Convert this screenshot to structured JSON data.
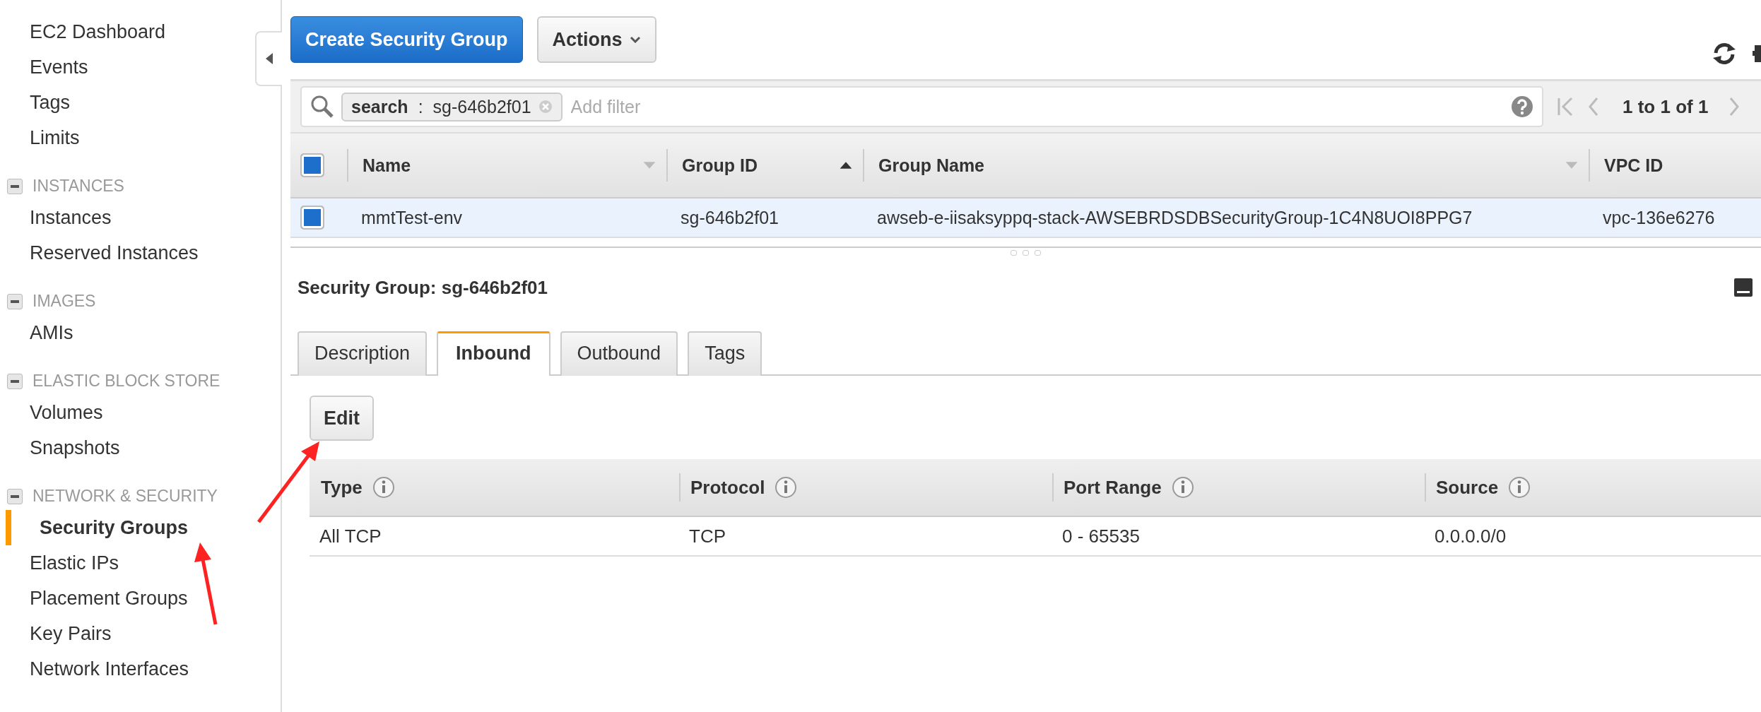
{
  "sidebar": {
    "items": [
      {
        "label": "EC2 Dashboard",
        "selected": false
      },
      {
        "label": "Events",
        "selected": false
      },
      {
        "label": "Tags",
        "selected": false
      },
      {
        "label": "Limits",
        "selected": false
      }
    ],
    "sections": [
      {
        "title": "INSTANCES",
        "expanded": true,
        "items": [
          {
            "label": "Instances",
            "selected": false
          },
          {
            "label": "Reserved Instances",
            "selected": false
          }
        ]
      },
      {
        "title": "IMAGES",
        "expanded": true,
        "items": [
          {
            "label": "AMIs",
            "selected": false
          }
        ]
      },
      {
        "title": "ELASTIC BLOCK STORE",
        "expanded": true,
        "items": [
          {
            "label": "Volumes",
            "selected": false
          },
          {
            "label": "Snapshots",
            "selected": false
          }
        ]
      },
      {
        "title": "NETWORK & SECURITY",
        "expanded": true,
        "items": [
          {
            "label": "Security Groups",
            "selected": true
          },
          {
            "label": "Elastic IPs",
            "selected": false
          },
          {
            "label": "Placement Groups",
            "selected": false
          },
          {
            "label": "Key Pairs",
            "selected": false
          },
          {
            "label": "Network Interfaces",
            "selected": false
          }
        ]
      }
    ]
  },
  "toolbar": {
    "primary_button": "Create Security Group",
    "actions_button": "Actions"
  },
  "filter": {
    "token_key": "search",
    "token_sep": ":",
    "token_value": "sg-646b2f01",
    "placeholder": "Add filter"
  },
  "pagination": {
    "text": "1 to 1 of 1"
  },
  "table": {
    "all_checked": true,
    "columns": [
      {
        "label": "Name",
        "sortable": true,
        "sorted": false
      },
      {
        "label": "Group ID",
        "sortable": true,
        "sorted": true
      },
      {
        "label": "Group Name",
        "sortable": true,
        "sorted": false
      },
      {
        "label": "VPC ID",
        "sortable": false,
        "sorted": false
      }
    ],
    "rows": [
      {
        "checked": true,
        "selected": true,
        "cells": [
          "mmtTest-env",
          "sg-646b2f01",
          "awseb-e-iisaksyppq-stack-AWSEBRDSDBSecurityGroup-1C4N8UOI8PPG7",
          "vpc-136e6276"
        ]
      }
    ]
  },
  "details": {
    "title": "Security Group: sg-646b2f01",
    "tabs": [
      {
        "label": "Description",
        "selected": false
      },
      {
        "label": "Inbound",
        "selected": true
      },
      {
        "label": "Outbound",
        "selected": false
      },
      {
        "label": "Tags",
        "selected": false
      }
    ],
    "edit_button": "Edit",
    "rules": {
      "columns": [
        "Type",
        "Protocol",
        "Port Range",
        "Source"
      ],
      "rows": [
        [
          "All TCP",
          "TCP",
          "0 - 65535",
          "0.0.0.0/0"
        ]
      ]
    }
  }
}
